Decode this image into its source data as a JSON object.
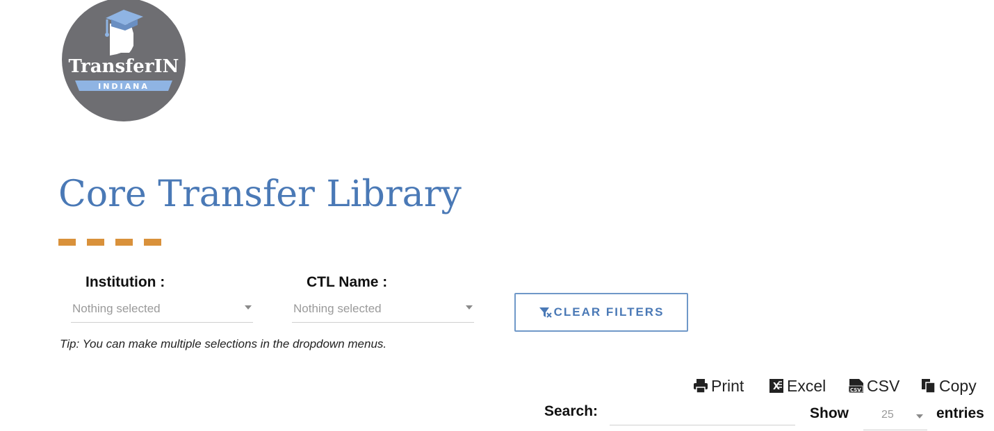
{
  "logo": {
    "brand": "TransferIN",
    "state": "INDIANA"
  },
  "page": {
    "title": "Core Transfer Library"
  },
  "filters": {
    "institution": {
      "label": "Institution :",
      "placeholder": "Nothing selected"
    },
    "ctl_name": {
      "label": "CTL Name :",
      "placeholder": "Nothing selected"
    },
    "clear_button_label": "CLEAR FILTERS",
    "tip": "Tip: You can make multiple selections in the dropdown menus."
  },
  "export": {
    "print": "Print",
    "excel": "Excel",
    "csv": "CSV",
    "copy": "Copy"
  },
  "table_controls": {
    "search_label": "Search:",
    "search_value": "",
    "show_label": "Show",
    "entries_value": "25",
    "entries_label": "entries"
  },
  "colors": {
    "accent_blue": "#4a79b6",
    "dash_orange": "#d9913b",
    "logo_gray": "#6e6e72",
    "logo_ribbon": "#8fb4e3"
  }
}
